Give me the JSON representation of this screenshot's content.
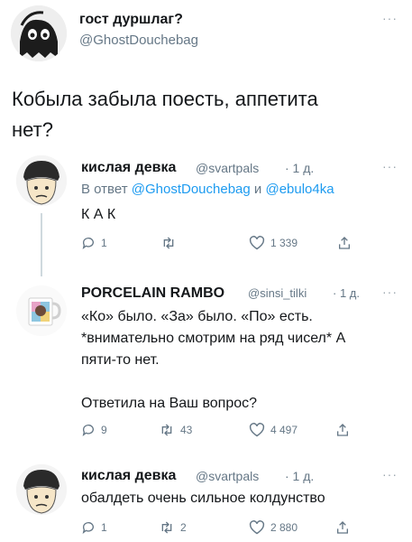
{
  "original_tweet": {
    "author_name": "гост дуршлаг?",
    "author_handle": "@GhostDouchebag",
    "text_line1": "Кобыла забыла поесть, аппетита",
    "text_line2": "нет?"
  },
  "reply1": {
    "author_name": "кислая девка",
    "author_handle": "@svartpals",
    "time": "· 1 д.",
    "replying_prefix": "В ответ",
    "replying_user1": "@GhostDouchebag",
    "replying_and": "и",
    "replying_user2": "@ebulo4ka",
    "text": "К А К",
    "replies": "1",
    "retweets": "",
    "likes": "1 339"
  },
  "reply2": {
    "author_name": "PORCELAIN RAMBO",
    "author_handle": "@sinsi_tilki",
    "time": "· 1 д.",
    "line1": "«Ко» было. «За» было. «По» есть.",
    "line2": "*внимательно смотрим на ряд чисел* А",
    "line3": "пяти-то нет.",
    "line4": "Ответила на Ваш вопрос?",
    "replies": "9",
    "retweets": "43",
    "likes": "4 497"
  },
  "reply3": {
    "author_name": "кислая девка",
    "author_handle": "@svartpals",
    "time": "· 1 д.",
    "text": "обалдеть очень сильное колдунство",
    "replies": "1",
    "retweets": "2",
    "likes": "2 880"
  },
  "more_symbol": "···"
}
